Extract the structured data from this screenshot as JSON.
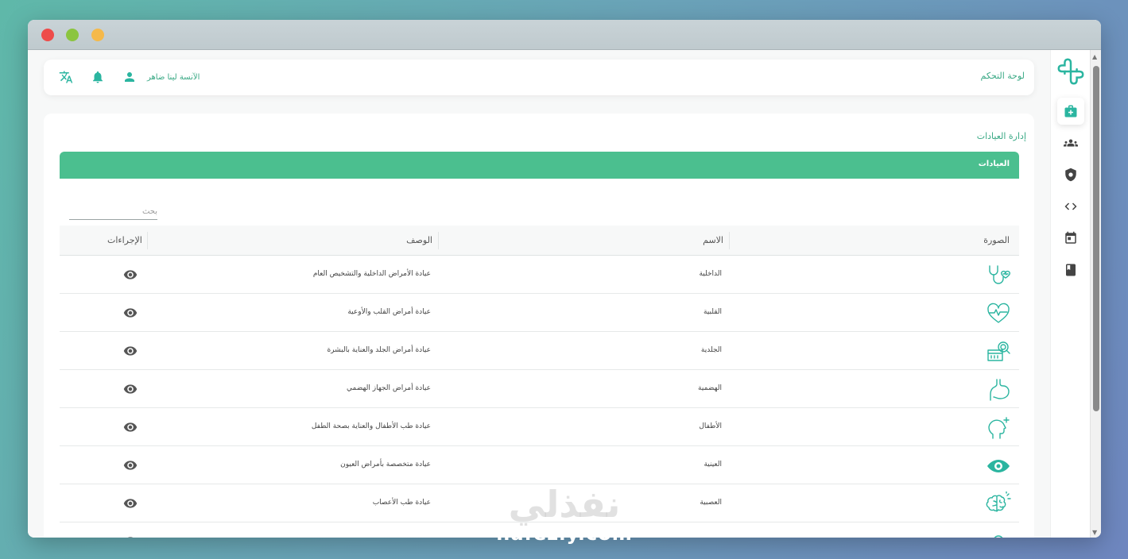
{
  "app": {
    "header": {
      "title": "لوحة التحكم",
      "username": "الآنسة لينا ضاهر"
    },
    "breadcrumb": "إدارة العيادات",
    "section_title": "العيادات",
    "search": {
      "placeholder": "بحث"
    },
    "table": {
      "columns": [
        "الصورة",
        "الاسم",
        "الوصف",
        "الإجراءات"
      ],
      "rows": [
        {
          "icon": "stethoscope-heart-icon",
          "name": "الداخلية",
          "description": "عيادة الأمراض الداخلية والتشخيص العام"
        },
        {
          "icon": "heart-pulse-icon",
          "name": "القلبية",
          "description": "عيادة أمراض القلب والأوعية"
        },
        {
          "icon": "skin-magnifier-icon",
          "name": "الجلدية",
          "description": "عيادة أمراض الجلد والعناية بالبشرة"
        },
        {
          "icon": "stomach-icon",
          "name": "الهضمية",
          "description": "عيادة أمراض الجهاز الهضمي"
        },
        {
          "icon": "child-head-icon",
          "name": "الأطفال",
          "description": "عيادة طب الأطفال والعناية بصحة الطفل"
        },
        {
          "icon": "eye-icon",
          "name": "العينية",
          "description": "عيادة متخصصة بأمراض العيون"
        },
        {
          "icon": "brain-icon",
          "name": "العصبية",
          "description": "عيادة طب الأعصاب"
        }
      ]
    },
    "sidebar_items": [
      "medical-kit-icon",
      "group-icon",
      "shield-icon",
      "code-icon",
      "calendar-icon",
      "book-icon"
    ],
    "colors": {
      "accent": "#4bbf8f",
      "accent_text": "#3aa985",
      "icon_teal": "#2bb5a0"
    }
  },
  "watermark": {
    "arabic": "نفذلي",
    "latin": "nafezly.com"
  }
}
